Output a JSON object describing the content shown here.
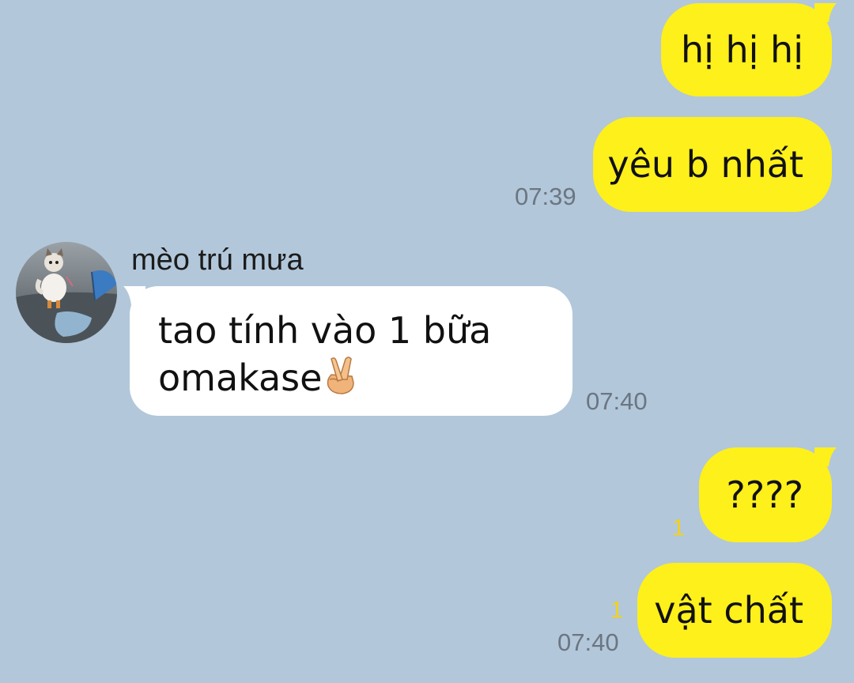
{
  "contact": {
    "name": "mèo trú mưa",
    "avatar_icon": "kitten-umbrella-avatar-icon"
  },
  "colors": {
    "background": "#b2c7da",
    "outgoing_bubble": "#fef01b",
    "incoming_bubble": "#ffffff",
    "unread": "#f2d21b"
  },
  "messages": [
    {
      "direction": "outgoing",
      "text": "hị hị hị"
    },
    {
      "direction": "outgoing",
      "text": "yêu b nhất",
      "time": "07:39"
    },
    {
      "direction": "incoming",
      "line1": "tao tính vào 1 bữa",
      "line2": "omakase",
      "emoji": "crossed-fingers-icon",
      "time": "07:40"
    },
    {
      "direction": "outgoing",
      "text": "????",
      "unread": "1"
    },
    {
      "direction": "outgoing",
      "text": "vật chất",
      "unread": "1",
      "time": "07:40"
    }
  ]
}
